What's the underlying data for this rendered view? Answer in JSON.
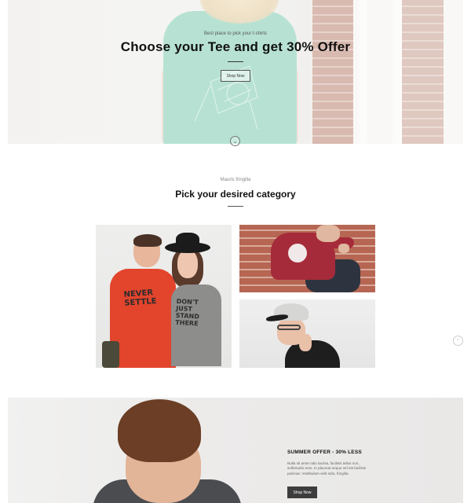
{
  "hero": {
    "tagline": "Best place to pick your t-shirts",
    "title": "Choose your Tee and get 30% Offer",
    "button_label": "Shop Now",
    "scroll_glyph": "⌄"
  },
  "category": {
    "kicker": "Mauris fringilla",
    "title": "Pick your desired category",
    "tiles": [
      {
        "name": "couple",
        "shirt_text_man": "NEVER SETTLE",
        "shirt_text_woman": "DON'T JUST STAND THERE"
      },
      {
        "name": "brick-wall"
      },
      {
        "name": "cap"
      }
    ]
  },
  "scroll_top_glyph": "⌃",
  "promo": {
    "title": "SUMMER OFFER - 30% LESS",
    "text": "Nulla sit amet odio lacinia, facilisis tellus non, sollicitudin eros. In placerat neque vel est facilisis pulvinar. Vestibulum velit odio, fringilla.",
    "button_label": "Shop Now"
  }
}
